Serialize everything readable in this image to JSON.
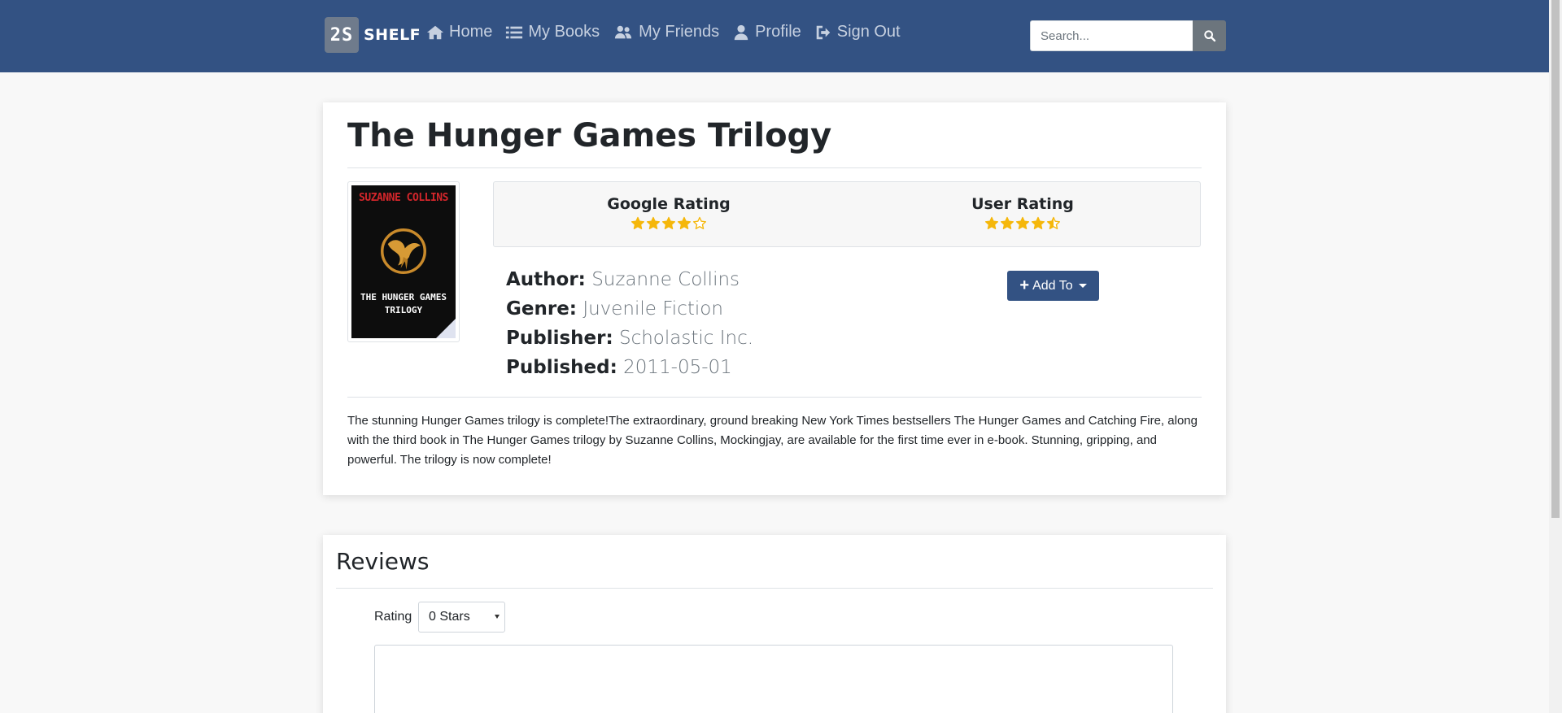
{
  "navbar": {
    "logo_mark": "2S",
    "logo_text": "SHELF",
    "links": [
      {
        "label": "Home",
        "icon": "home-icon"
      },
      {
        "label": "My Books",
        "icon": "list-icon"
      },
      {
        "label": "My Friends",
        "icon": "users-icon"
      },
      {
        "label": "Profile",
        "icon": "user-icon"
      },
      {
        "label": "Sign Out",
        "icon": "sign-out-icon"
      }
    ],
    "search_placeholder": "Search..."
  },
  "book": {
    "title": "The Hunger Games Trilogy",
    "cover": {
      "author": "SUZANNE COLLINS",
      "title": "THE HUNGER GAMES TRILOGY"
    },
    "google_rating_label": "Google Rating",
    "google_rating": 4,
    "user_rating_label": "User Rating",
    "user_rating": 4.5,
    "author_label": "Author:",
    "author": "Suzanne Collins",
    "genre_label": "Genre:",
    "genre": "Juvenile Fiction",
    "publisher_label": "Publisher:",
    "publisher": "Scholastic Inc.",
    "published_label": "Published:",
    "published": "2011-05-01",
    "add_to_label": "Add To",
    "description": "The stunning Hunger Games trilogy is complete!The extraordinary, ground breaking New York Times bestsellers The Hunger Games and Catching Fire, along with the third book in The Hunger Games trilogy by Suzanne Collins, Mockingjay, are available for the first time ever in e-book. Stunning, gripping, and powerful. The trilogy is now complete!"
  },
  "reviews": {
    "title": "Reviews",
    "rating_label": "Rating",
    "rating_selected": "0 Stars"
  },
  "colors": {
    "navbar": "#335283",
    "star": "#f5b70a",
    "button": "#335283"
  }
}
